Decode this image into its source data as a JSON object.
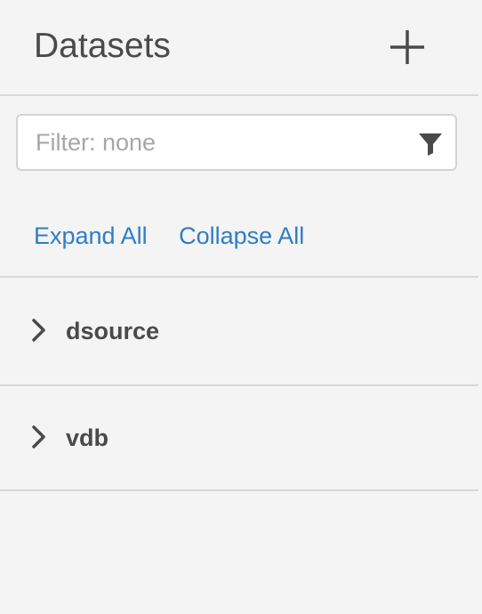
{
  "header": {
    "title": "Datasets",
    "add_icon": "plus-icon"
  },
  "filter": {
    "placeholder": "Filter: none",
    "value": "",
    "icon": "funnel-icon"
  },
  "actions": {
    "expand_all": "Expand All",
    "collapse_all": "Collapse All"
  },
  "tree": {
    "items": [
      {
        "label": "dsource",
        "expanded": false,
        "icon": "chevron-right-icon"
      },
      {
        "label": "vdb",
        "expanded": false,
        "icon": "chevron-right-icon"
      }
    ]
  },
  "colors": {
    "background": "#f4f4f4",
    "link": "#2f7dc5",
    "text": "#4a4a4a",
    "placeholder": "#a7a7a7",
    "divider": "#d8d8d8"
  }
}
